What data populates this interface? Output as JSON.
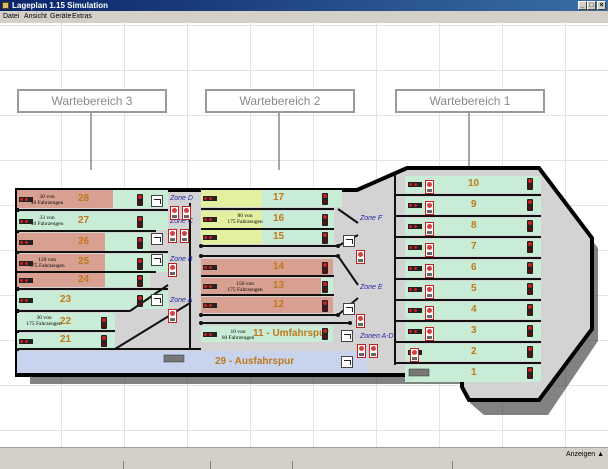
{
  "window": {
    "title": "Lageplan 1.15 Simulation"
  },
  "menu": [
    "Datei",
    "Ansicht",
    "Geräte",
    "Extras"
  ],
  "waiting_areas": [
    "Wartebereich 3",
    "Wartebereich 2",
    "Wartebereich 1"
  ],
  "lanes": {
    "l28": "28",
    "l27": "27",
    "l26": "26",
    "l25": "25",
    "l24": "24",
    "l23": "23",
    "l22": "22",
    "l21": "21",
    "l17": "17",
    "l16": "16",
    "l15": "15",
    "l14": "14",
    "l13": "13",
    "l12": "12",
    "l11": "11 - Umfahrspur",
    "l29": "29 - Ausfahrspur",
    "l10": "10",
    "l9": "9",
    "l8": "8",
    "l7": "7",
    "l6": "6",
    "l5": "5",
    "l4": "4",
    "l3": "3",
    "l2": "2",
    "l1": "1"
  },
  "zones": {
    "d": "Zone D",
    "c": "Zone C",
    "b": "Zone B",
    "a": "Zone A",
    "f": "Zone F",
    "e": "Zone E",
    "ad": "Zonen A-D"
  },
  "info": {
    "i28_1": "30 von",
    "i28_2": "40 Fahrzeugen",
    "i27_1": "33 von",
    "i27_2": "40 Fahrzeugen",
    "i25_1": "120 von",
    "i25_2": "175 Fahrzeugen",
    "i22_1": "30 von",
    "i22_2": "175 Fahrzeugen",
    "i16_1": "80 von",
    "i16_2": "175 Fahrzeugen",
    "i13_1": "150 von",
    "i13_2": "175 Fahrzeugen",
    "i11_1": "10 von",
    "i11_2": "60 Fahrzeugen"
  },
  "status": {
    "show_label": "Anzeigen ▲"
  },
  "colors": {
    "green": "#c8ecd5",
    "red": "#d8a090",
    "yellow": "#e4f0a0",
    "grey_area": "#d3d3d3",
    "exit_lane": "#c8d4ee",
    "zone_label": "#2525a8",
    "lane_number": "#c0781c"
  }
}
